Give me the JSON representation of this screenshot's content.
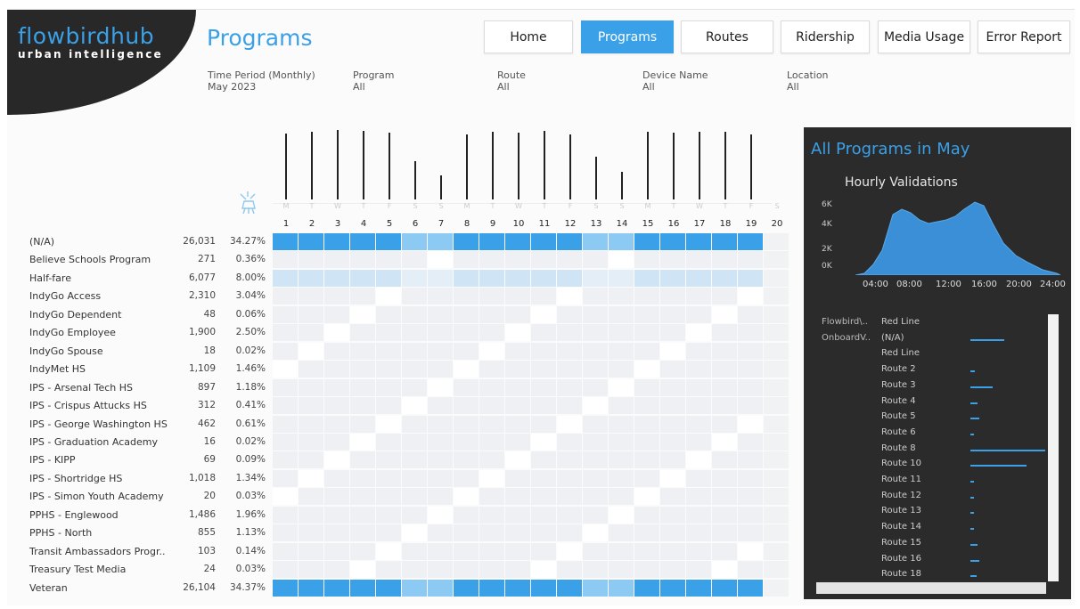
{
  "logo": {
    "main": "flowbirdhub",
    "sub": "urban intelligence"
  },
  "page_title": "Programs",
  "nav": [
    {
      "label": "Home",
      "active": false
    },
    {
      "label": "Programs",
      "active": true
    },
    {
      "label": "Routes",
      "active": false
    },
    {
      "label": "Ridership",
      "active": false
    },
    {
      "label": "Media Usage",
      "active": false
    },
    {
      "label": "Error Report",
      "active": false
    }
  ],
  "filters": [
    {
      "label": "Time Period (Monthly)",
      "value": "May 2023"
    },
    {
      "label": "Program",
      "value": "All"
    },
    {
      "label": "Route",
      "value": "All"
    },
    {
      "label": "Device Name",
      "value": "All"
    },
    {
      "label": "Location",
      "value": "All"
    }
  ],
  "days": {
    "letters": [
      "M",
      "T",
      "W",
      "T",
      "F",
      "S",
      "S",
      "M",
      "T",
      "W",
      "T",
      "F",
      "S",
      "S",
      "M",
      "T",
      "W",
      "T",
      "F",
      "S"
    ],
    "numbers": [
      "1",
      "2",
      "3",
      "4",
      "5",
      "6",
      "7",
      "8",
      "9",
      "10",
      "11",
      "12",
      "13",
      "14",
      "15",
      "16",
      "17",
      "18",
      "19",
      "20"
    ],
    "relative_volume": [
      0.95,
      0.98,
      1.0,
      0.99,
      0.96,
      0.55,
      0.35,
      0.94,
      0.98,
      0.96,
      0.99,
      0.93,
      0.62,
      0.4,
      0.97,
      0.96,
      0.97,
      0.98,
      0.94,
      0
    ]
  },
  "programs": [
    {
      "name": "(N/A)",
      "count": "26,031",
      "pct": "34.27%"
    },
    {
      "name": "Believe Schools Program",
      "count": "271",
      "pct": "0.36%"
    },
    {
      "name": "Half-fare",
      "count": "6,077",
      "pct": "8.00%"
    },
    {
      "name": "IndyGo Access",
      "count": "2,310",
      "pct": "3.04%"
    },
    {
      "name": "IndyGo Dependent",
      "count": "48",
      "pct": "0.06%"
    },
    {
      "name": "IndyGo Employee",
      "count": "1,900",
      "pct": "2.50%"
    },
    {
      "name": "IndyGo Spouse",
      "count": "18",
      "pct": "0.02%"
    },
    {
      "name": "IndyMet HS",
      "count": "1,109",
      "pct": "1.46%"
    },
    {
      "name": "IPS - Arsenal Tech HS",
      "count": "897",
      "pct": "1.18%"
    },
    {
      "name": "IPS - Crispus Attucks HS",
      "count": "312",
      "pct": "0.41%"
    },
    {
      "name": "IPS - George Washington HS",
      "count": "462",
      "pct": "0.61%"
    },
    {
      "name": "IPS - Graduation Academy",
      "count": "16",
      "pct": "0.02%"
    },
    {
      "name": "IPS - KIPP",
      "count": "69",
      "pct": "0.09%"
    },
    {
      "name": "IPS - Shortridge HS",
      "count": "1,018",
      "pct": "1.34%"
    },
    {
      "name": "IPS - Simon Youth Academy",
      "count": "20",
      "pct": "0.03%"
    },
    {
      "name": "PPHS - Englewood",
      "count": "1,486",
      "pct": "1.96%"
    },
    {
      "name": "PPHS - North",
      "count": "855",
      "pct": "1.13%"
    },
    {
      "name": "Transit Ambassadors Progr..",
      "count": "103",
      "pct": "0.14%"
    },
    {
      "name": "Treasury Test Media",
      "count": "24",
      "pct": "0.03%"
    },
    {
      "name": "Veteran",
      "count": "26,104",
      "pct": "34.37%"
    }
  ],
  "panel": {
    "title": "All Programs in May",
    "chart_title": "Hourly Validations",
    "y_ticks": [
      "6K",
      "4K",
      "2K",
      "0K"
    ],
    "x_ticks": [
      "04:00",
      "08:00",
      "12:00",
      "16:00",
      "20:00",
      "24:00"
    ],
    "left_labels": [
      "Flowbird\\..",
      "OnboardV.."
    ],
    "routes": [
      {
        "label": "Red Line",
        "rel": 0
      },
      {
        "label": "(N/A)",
        "rel": 0.45
      },
      {
        "label": "Red Line",
        "rel": 0
      },
      {
        "label": "Route 2",
        "rel": 0.06
      },
      {
        "label": "Route 3",
        "rel": 0.3
      },
      {
        "label": "Route 4",
        "rel": 0.1
      },
      {
        "label": "Route 5",
        "rel": 0.12
      },
      {
        "label": "Route 6",
        "rel": 0.05
      },
      {
        "label": "Route 8",
        "rel": 1.0
      },
      {
        "label": "Route 10",
        "rel": 0.75
      },
      {
        "label": "Route 11",
        "rel": 0.03
      },
      {
        "label": "Route 12",
        "rel": 0.03
      },
      {
        "label": "Route 13",
        "rel": 0.03
      },
      {
        "label": "Route 14",
        "rel": 0.05
      },
      {
        "label": "Route 15",
        "rel": 0.1
      },
      {
        "label": "Route 16",
        "rel": 0.12
      },
      {
        "label": "Route 18",
        "rel": 0.08
      }
    ]
  },
  "colors": {
    "accent": "#3aa0e8",
    "dark": "#2b2b2b"
  }
}
